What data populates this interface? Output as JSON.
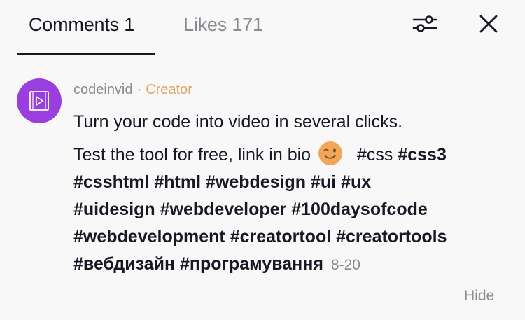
{
  "tabs": {
    "comments": "Comments 1",
    "likes": "Likes 171"
  },
  "icons": {
    "filter": "sliders-filter-icon",
    "close": "close-icon",
    "avatar": "play-video-icon",
    "emoji": "winking-face-emoji"
  },
  "colors": {
    "avatar_bg": "#9b3ee0",
    "creator_badge": "#e6a161",
    "muted_text": "#8a8b91",
    "primary_text": "#161823"
  },
  "comment": {
    "username": "codeinvid",
    "separator": "·",
    "badge": "Creator",
    "line1": "Turn your code into video in several clicks.",
    "line2_text": "Test the tool for free, link in bio",
    "tags": {
      "css": "#css",
      "css3": "#css3",
      "csshtml": "#csshtml",
      "html": "#html",
      "webdesign": "#webdesign",
      "ui": "#ui",
      "ux": "#ux",
      "uidesign": "#uidesign",
      "webdeveloper": "#webdeveloper",
      "days": "#100daysofcode",
      "webdevelopment": "#webdevelopment",
      "creatortool": "#creatortool",
      "creatortools": "#creatortools",
      "vebdyzain": "#вебдизайн",
      "prohramuvannia": "#програмування"
    },
    "date": "8-20"
  },
  "actions": {
    "hide": "Hide"
  }
}
